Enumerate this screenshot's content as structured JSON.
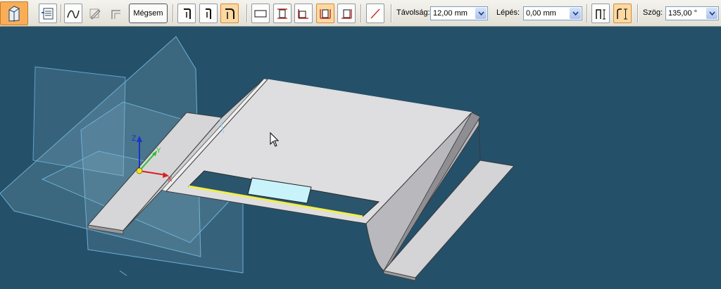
{
  "toolbar": {
    "cancel_label": "Mégsem",
    "distance": {
      "label": "Távolság:",
      "value": "12,00 mm"
    },
    "step": {
      "label": "Lépés:",
      "value": "0,00 mm"
    },
    "angle": {
      "label": "Szög:",
      "value": "135,00 °"
    }
  },
  "triad": {
    "x": "X",
    "y": "Y",
    "z": "Z"
  },
  "colors": {
    "viewport_bg": "#25506a",
    "active_button": "#fcd9a2",
    "selection": "#f2ee4a"
  }
}
